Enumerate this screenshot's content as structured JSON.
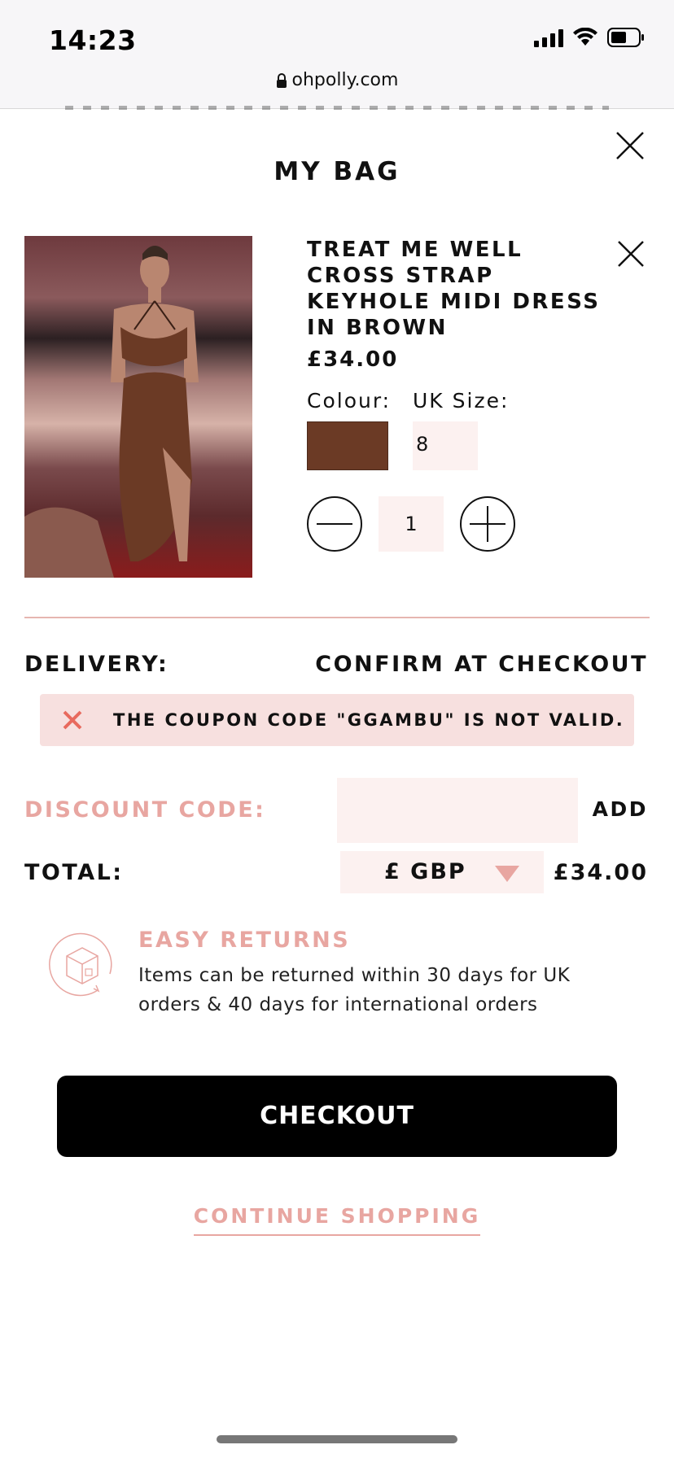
{
  "status_bar": {
    "time": "14:23",
    "icons": [
      "signal-icon",
      "wifi-icon",
      "battery-icon"
    ]
  },
  "browser": {
    "url": "ohpolly.com"
  },
  "bag": {
    "title": "MY BAG",
    "item": {
      "name": "TREAT ME WELL CROSS STRAP KEYHOLE MIDI DRESS IN BROWN",
      "price": "£34.00",
      "colour_label": "Colour:",
      "colour_swatch": "#6b3a25",
      "size_label": "UK Size:",
      "size_value": "8",
      "quantity": "1"
    },
    "delivery": {
      "label": "DELIVERY:",
      "value": "CONFIRM AT CHECKOUT"
    },
    "coupon_error": {
      "message": "THE COUPON CODE \"GGAMBU\" IS NOT VALID."
    },
    "discount": {
      "label": "DISCOUNT CODE:",
      "value": "",
      "add_label": "ADD"
    },
    "total": {
      "label": "TOTAL:",
      "currency": "£ GBP",
      "value": "£34.00"
    },
    "returns": {
      "title": "EASY RETURNS",
      "text": "Items can be returned within 30 days for UK orders & 40 days for international orders"
    },
    "checkout_label": "CHECKOUT",
    "continue_label": "CONTINUE SHOPPING"
  },
  "colors": {
    "accent_pink": "#e8a6a1",
    "field_bg": "#fcf1f0",
    "error_bg": "#f7e0df",
    "error_x": "#e86a5e",
    "button_black": "#000000"
  }
}
